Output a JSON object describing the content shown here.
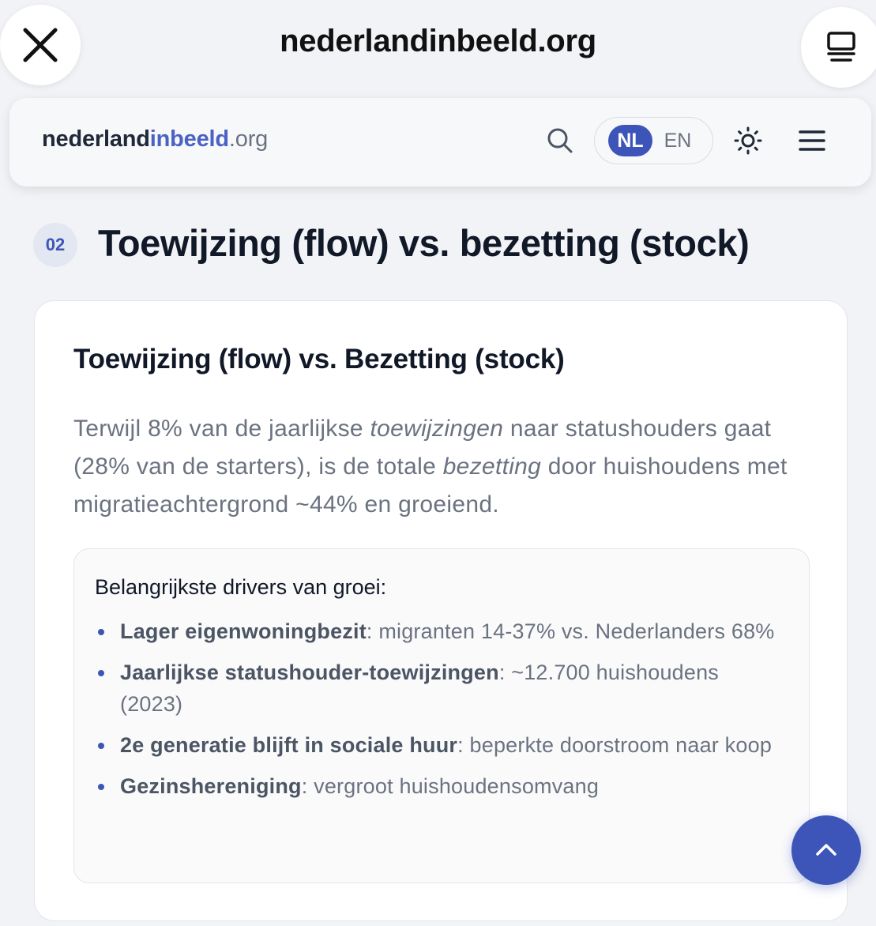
{
  "browser": {
    "domain": "nederlandinbeeld.org",
    "close_icon": "close-icon",
    "tabs_icon": "tabs-icon"
  },
  "header": {
    "logo_part1": "nederland",
    "logo_part2": "inbeeld",
    "logo_part3": ".org",
    "search_icon": "search-icon",
    "lang_nl": "NL",
    "lang_en": "EN",
    "theme_icon": "sun-icon",
    "menu_icon": "hamburger-menu-icon"
  },
  "section": {
    "number": "02",
    "title": "Toewijzing (flow) vs. bezetting (stock)"
  },
  "card": {
    "title": "Toewijzing (flow) vs. Bezetting (stock)",
    "text_1": "Terwijl 8% van de jaarlijkse ",
    "text_em1": "toewijzingen",
    "text_2": " naar statushouders gaat (28% van de starters), is de totale ",
    "text_em2": "bezetting",
    "text_3": " door huishoudens met migratieachtergrond ~44% en groeiend.",
    "drivers_title": "Belangrijkste drivers van groei:",
    "drivers": [
      {
        "label": "Lager eigenwoningbezit",
        "text": ": migranten 14-37% vs. Nederlanders 68%"
      },
      {
        "label": "Jaarlijkse statushouder-toewijzingen",
        "text": ": ~12.700 huishoudens (2023)"
      },
      {
        "label": "2e generatie blijft in sociale huur",
        "text": ": beperkte doorstroom naar koop"
      },
      {
        "label": "Gezinshereniging",
        "text": ": vergroot huishoudensomvang"
      }
    ]
  },
  "colors": {
    "accent": "#3d55b8",
    "logo_accent": "#4a62c4",
    "muted_text": "#6b7280",
    "page_bg": "#f2f3f6"
  },
  "scroll_top_icon": "chevron-up-icon"
}
